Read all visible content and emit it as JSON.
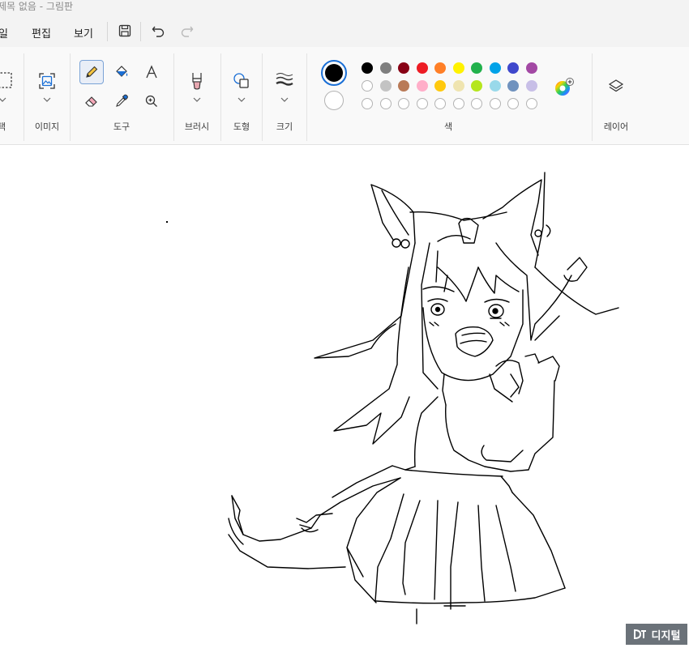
{
  "window": {
    "title": "제목 없음 - 그림판"
  },
  "menu": {
    "file": "일",
    "edit": "편집",
    "view": "보기"
  },
  "groups": {
    "select": "택",
    "image": "이미지",
    "tools": "도구",
    "brushes": "브러시",
    "shapes": "도형",
    "size": "크기",
    "colors": "색",
    "layers": "레이어"
  },
  "palette": {
    "row1": [
      "#000000",
      "#7f7f7f",
      "#880015",
      "#ed1c24",
      "#ff7f27",
      "#fff200",
      "#22b14c",
      "#00a2e8",
      "#3f48cc",
      "#a349a4"
    ],
    "row2": [
      "#ffffff",
      "#c3c3c3",
      "#b97a57",
      "#ffaec9",
      "#ffc90e",
      "#efe4b0",
      "#b5e61d",
      "#99d9ea",
      "#7092be",
      "#c8bfe7"
    ],
    "row3_empty_slots": 10
  },
  "current_colors": {
    "primary": "#000000",
    "secondary": "#ffffff"
  },
  "icons": [
    "select-icon",
    "image-icon",
    "pencil-icon",
    "fill-icon",
    "text-icon",
    "eraser-icon",
    "color-picker-icon",
    "magnifier-icon",
    "brush-icon",
    "shapes-icon",
    "size-icon",
    "edit-colors-icon",
    "layers-icon",
    "save-icon",
    "undo-icon",
    "redo-icon"
  ],
  "watermark": {
    "text": "디지털"
  }
}
